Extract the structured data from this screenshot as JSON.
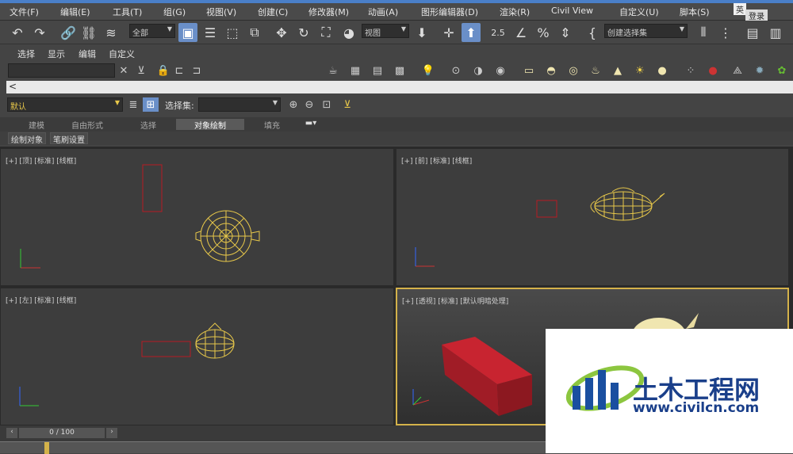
{
  "menu": [
    "文件(F)",
    "编辑(E)",
    "工具(T)",
    "组(G)",
    "视图(V)",
    "创建(C)",
    "修改器(M)",
    "动画(A)",
    "图形编辑器(D)",
    "渲染(R)",
    "Civil View",
    "自定义(U)",
    "脚本(S)"
  ],
  "account": {
    "login_label": "登录",
    "logo_text": "英"
  },
  "toolbar": {
    "filter_dropdown": "全部",
    "refcoord_dropdown": "视图",
    "selection_set_dropdown": "创建选择集",
    "snap_label": "2.5"
  },
  "ribbon_tabs": [
    "选择",
    "显示",
    "编辑",
    "自定义"
  ],
  "command_bar": {
    "prompt": "<"
  },
  "layer": {
    "current_layer": "默认",
    "selection_set_label": "选择集:"
  },
  "graphite_tabs": [
    "建模",
    "自由形式",
    "选择",
    "对象绘制",
    "填充"
  ],
  "graphite_active": "对象绘制",
  "panel_tabs": [
    "绘制对象",
    "笔刷设置"
  ],
  "viewports": [
    {
      "label": "[+] [顶] [标准] [线框]"
    },
    {
      "label": "[+] [前] [标准] [线框]"
    },
    {
      "label": "[+] [左] [标准] [线框]"
    },
    {
      "label": "[+] [透视] [标准] [默认明暗处理]"
    }
  ],
  "timeline": {
    "frame_display": "0 / 100"
  },
  "watermark": {
    "cn_text": "土木工程网",
    "url": "www.civilcn.com"
  },
  "colors": {
    "wire_yellow": "#e8c84a",
    "box_red": "#b81c24",
    "active_border": "#d4b24a",
    "accent_blue": "#4a7fc8"
  }
}
